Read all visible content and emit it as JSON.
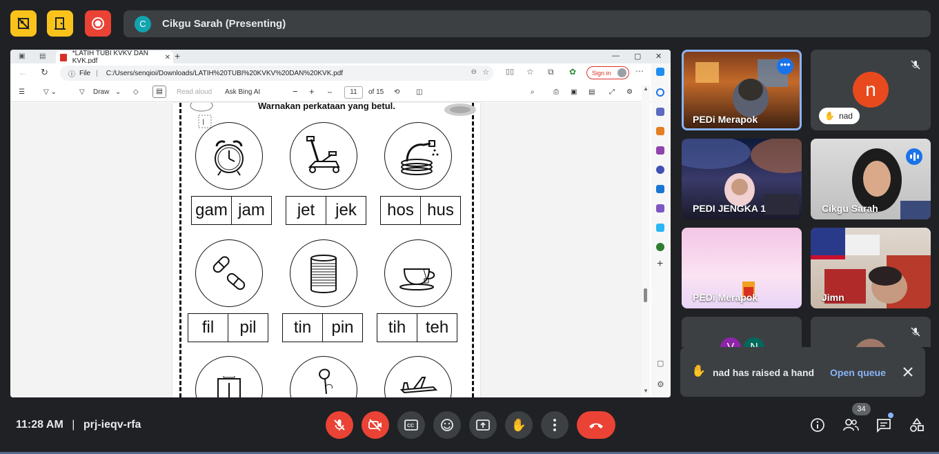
{
  "top_bar": {
    "presenter_initial": "C",
    "presenter_label": "Cikgu Sarah (Presenting)"
  },
  "browser": {
    "tab_title": "*LATIH TUBI KVKV DAN KVK.pdf",
    "url_label": "File",
    "url": "C:/Users/senqioi/Downloads/LATIH%20TUBI%20KVKV%20DAN%20KVK.pdf",
    "sign_in": "Sign in",
    "toolbar": {
      "draw": "Draw",
      "read_aloud": "Read aloud",
      "ask_bing": "Ask Bing AI",
      "minus": "−",
      "plus": "+",
      "page_current": "11",
      "page_total": "of 15"
    }
  },
  "worksheet": {
    "instruction": "Warnakan perkataan yang betul.",
    "rows": [
      [
        {
          "picture": "alarm-clock",
          "choices": [
            "gam",
            "jam"
          ]
        },
        {
          "picture": "car-jack",
          "choices": [
            "jet",
            "jek"
          ]
        },
        {
          "picture": "water-hose",
          "choices": [
            "hos",
            "hus"
          ]
        }
      ],
      [
        {
          "picture": "pills",
          "choices": [
            "fil",
            "pil"
          ]
        },
        {
          "picture": "tin-can",
          "choices": [
            "tin",
            "pin"
          ]
        },
        {
          "picture": "tea-cup",
          "choices": [
            "tih",
            "teh"
          ]
        }
      ],
      [
        {
          "picture": "elevator",
          "choices": []
        },
        {
          "picture": "rose",
          "choices": []
        },
        {
          "picture": "jet-plane",
          "choices": []
        }
      ]
    ]
  },
  "participants": [
    {
      "name": "PEDi Merapok",
      "state": "active"
    },
    {
      "name": "nad",
      "initial": "n",
      "state": "muted"
    },
    {
      "name": "PEDI JENGKA 1",
      "state": "video"
    },
    {
      "name": "Cikgu Sarah",
      "state": "speaking"
    },
    {
      "name": "PEDi Merapok",
      "state": "video"
    },
    {
      "name": "Jimn",
      "state": "video"
    },
    {
      "name": "",
      "initials": [
        "V",
        "N"
      ],
      "state": "group"
    },
    {
      "name": "",
      "state": "muted"
    }
  ],
  "toast": {
    "message": "nad has raised a hand",
    "action": "Open queue"
  },
  "bottom_bar": {
    "time": "11:28 AM",
    "separator": "|",
    "meeting_code": "prj-ieqv-rfa",
    "people_count": "34"
  },
  "colors": {
    "background": "#202124",
    "panel": "#3c4043",
    "accent_blue": "#8ab4f8",
    "danger_red": "#ea4335",
    "warn_yellow": "#f9c31c"
  }
}
